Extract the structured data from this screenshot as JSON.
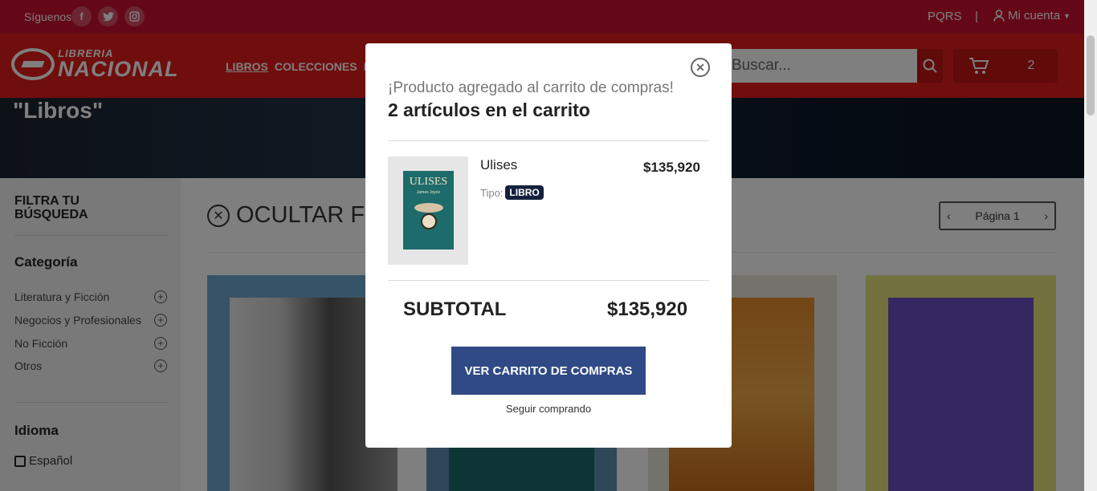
{
  "topbar": {
    "social_label": "Síguenos",
    "social": [
      {
        "icon": "facebook-icon",
        "glyph": "f"
      },
      {
        "icon": "twitter-icon",
        "glyph": "t"
      },
      {
        "icon": "instagram-icon",
        "glyph": "◎"
      }
    ],
    "pqrs": "PQRS",
    "separator": "|",
    "account": "Mi cuenta"
  },
  "header": {
    "logo_line1": "LIBRERIA",
    "logo_line2": "NACIONAL",
    "nav": [
      "LIBROS",
      "COLECCIONES",
      "PR"
    ],
    "search_placeholder": "Buscar...",
    "cart_count": "2"
  },
  "banner": {
    "title": "\"Libros\""
  },
  "sidebar": {
    "filter_title": "FILTRA TU BÚSQUEDA",
    "category_heading": "Categoría",
    "categories": [
      "Literatura y Ficción",
      "Negocios y Profesionales",
      "No Ficción",
      "Otros"
    ],
    "language_heading": "Idioma",
    "languages": [
      "Español"
    ]
  },
  "main": {
    "hide_filters": "OCULTAR FI",
    "pager": "Página 1"
  },
  "modal": {
    "subtitle": "¡Producto agregado al carrito de compras!",
    "title": "2 artículos en el carrito",
    "product": {
      "name": "Ulises",
      "price": "$135,920",
      "type_label": "Tipo:",
      "type_value": "LIBRO",
      "cover_title": "ULISES",
      "cover_author": "James Joyce"
    },
    "subtotal_label": "SUBTOTAL",
    "subtotal_value": "$135,920",
    "view_cart": "VER CARRITO DE COMPRAS",
    "continue": "Seguir comprando"
  },
  "colors": {
    "brand_red": "#e01b1b",
    "button_blue": "#2f4a85",
    "badge_navy": "#14213d"
  }
}
